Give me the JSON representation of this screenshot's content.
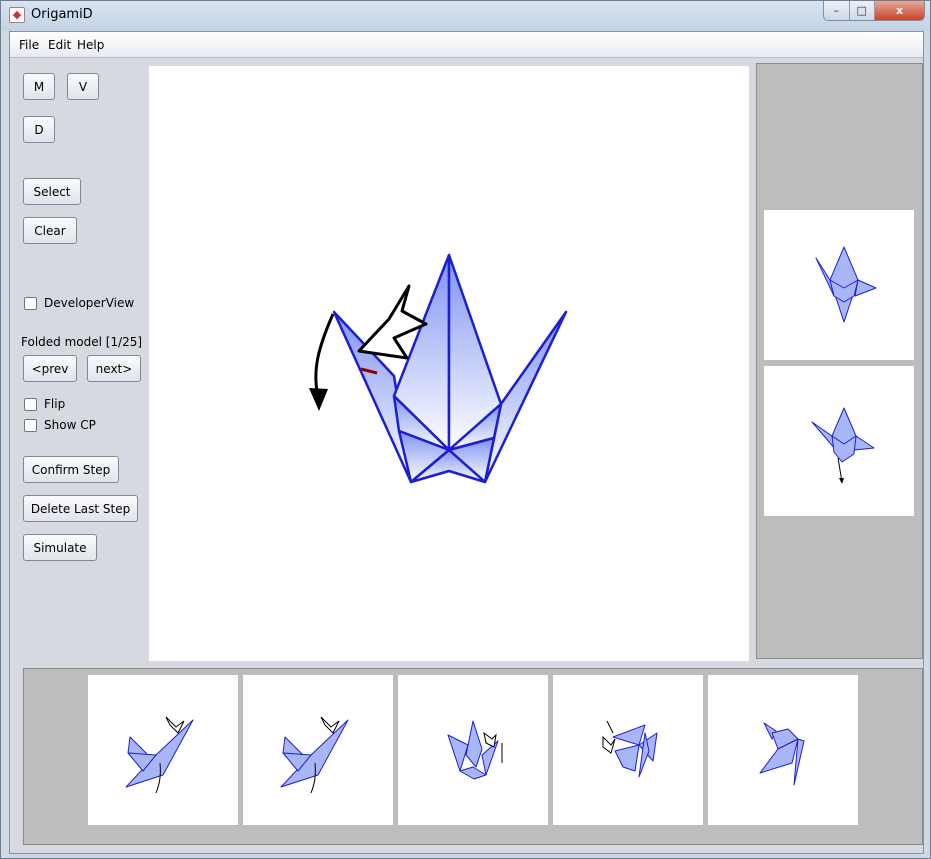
{
  "window": {
    "title": "OrigamiD",
    "controls": {
      "minimize": "–",
      "maximize": "□",
      "close": "x"
    }
  },
  "menu": {
    "file": "File",
    "edit": "Edit",
    "help": "Help"
  },
  "left_panel": {
    "mountain_button": "M",
    "valley_button": "V",
    "d_button": "D",
    "select_button": "Select",
    "clear_button": "Clear",
    "developer_view": {
      "label": "DeveloperView",
      "checked": false
    },
    "folded_model_label": "Folded model [1/25]",
    "prev_button": "<prev",
    "next_button": "next>",
    "flip": {
      "label": "Flip",
      "checked": false
    },
    "show_cp": {
      "label": "Show CP",
      "checked": false
    },
    "confirm_step_button": "Confirm Step",
    "delete_last_step_button": "Delete Last Step",
    "simulate_button": "Simulate"
  },
  "colors": {
    "paper_fill_top": "#7f93f2",
    "paper_fill_bottom": "#ffffff",
    "paper_edge": "#1a1ed6",
    "highlight_crease": "#8b0000",
    "panel_gray": "#bdbdbd"
  },
  "icons": {
    "app": "origami-app-icon",
    "fold_arrow": "fold-arrow-icon",
    "push_arrow": "push-arrow-icon"
  }
}
